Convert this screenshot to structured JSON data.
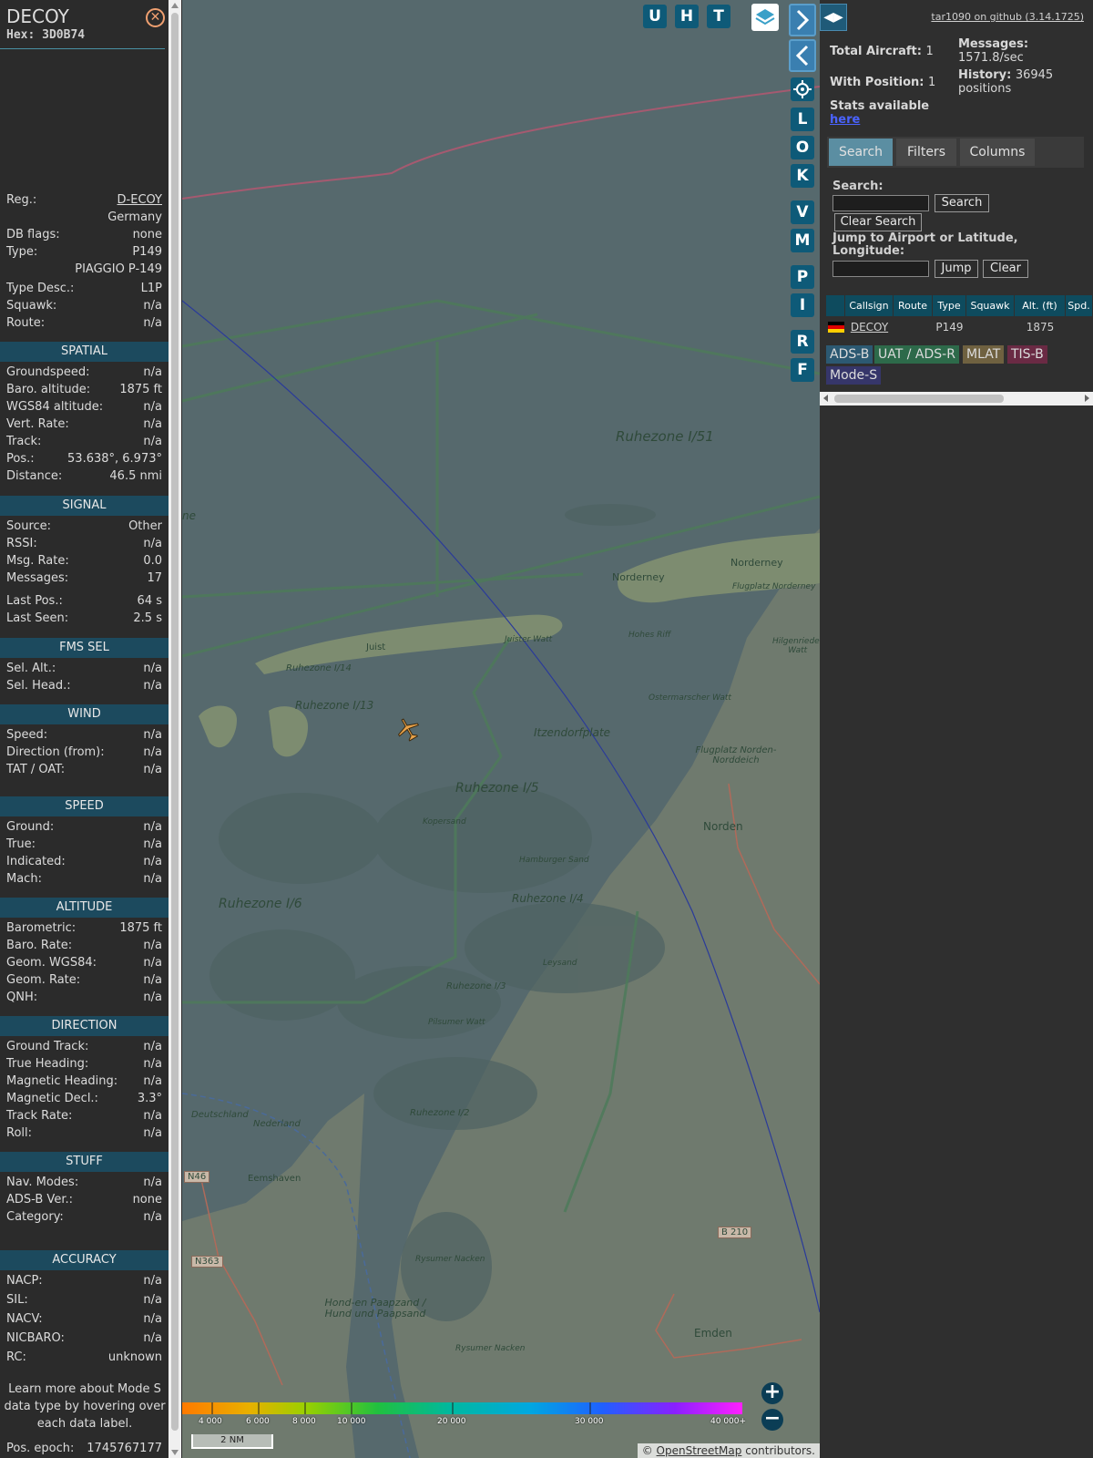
{
  "aircraft": {
    "callsign": "DECOY",
    "hex_label": "Hex:",
    "hex": "3D0B74",
    "close_icon": "close-circle-icon"
  },
  "details": [
    {
      "k": "Reg.:",
      "v": "D-ECOY",
      "link": true
    },
    {
      "k": "",
      "v": "Germany"
    },
    {
      "k": "DB flags:",
      "v": "none"
    },
    {
      "k": "Type:",
      "v": "P149"
    },
    {
      "k": "",
      "v": "PIAGGIO P-149"
    },
    {
      "k": "Type Desc.:",
      "v": "L1P"
    },
    {
      "k": "Squawk:",
      "v": "n/a"
    },
    {
      "k": "Route:",
      "v": "n/a"
    }
  ],
  "sections": [
    {
      "title": "SPATIAL",
      "rows": [
        {
          "k": "Groundspeed:",
          "v": "n/a"
        },
        {
          "k": "Baro. altitude:",
          "v": "1875 ft"
        },
        {
          "k": "WGS84 altitude:",
          "v": "n/a"
        },
        {
          "k": "Vert. Rate:",
          "v": "n/a"
        },
        {
          "k": "Track:",
          "v": "n/a"
        },
        {
          "k": "Pos.:",
          "v": "53.638°, 6.973°"
        },
        {
          "k": "Distance:",
          "v": "46.5 nmi"
        }
      ]
    },
    {
      "title": "SIGNAL",
      "rows": [
        {
          "k": "Source:",
          "v": "Other"
        },
        {
          "k": "RSSI:",
          "v": "n/a"
        },
        {
          "k": "Msg. Rate:",
          "v": "0.0"
        },
        {
          "k": "Messages:",
          "v": "17"
        },
        {
          "k": "Last Pos.:",
          "v": "64 s"
        },
        {
          "k": "Last Seen:",
          "v": "2.5 s"
        }
      ]
    },
    {
      "title": "FMS SEL",
      "rows": [
        {
          "k": "Sel. Alt.:",
          "v": "n/a"
        },
        {
          "k": "Sel. Head.:",
          "v": "n/a"
        }
      ]
    },
    {
      "title": "WIND",
      "rows": [
        {
          "k": "Speed:",
          "v": "n/a"
        },
        {
          "k": "Direction (from):",
          "v": "n/a"
        },
        {
          "k": "TAT / OAT:",
          "v": "n/a"
        }
      ]
    },
    {
      "title": "SPEED",
      "rows": [
        {
          "k": "Ground:",
          "v": "n/a"
        },
        {
          "k": "True:",
          "v": "n/a"
        },
        {
          "k": "Indicated:",
          "v": "n/a"
        },
        {
          "k": "Mach:",
          "v": "n/a"
        }
      ]
    },
    {
      "title": "ALTITUDE",
      "rows": [
        {
          "k": "Barometric:",
          "v": "1875 ft"
        },
        {
          "k": "Baro. Rate:",
          "v": "n/a"
        },
        {
          "k": "Geom. WGS84:",
          "v": "n/a"
        },
        {
          "k": "Geom. Rate:",
          "v": "n/a"
        },
        {
          "k": "QNH:",
          "v": "n/a"
        }
      ]
    },
    {
      "title": "DIRECTION",
      "rows": [
        {
          "k": "Ground Track:",
          "v": "n/a"
        },
        {
          "k": "True Heading:",
          "v": "n/a"
        },
        {
          "k": "Magnetic Heading:",
          "v": "n/a"
        },
        {
          "k": "Magnetic Decl.:",
          "v": "3.3°"
        },
        {
          "k": "Track Rate:",
          "v": "n/a"
        },
        {
          "k": "Roll:",
          "v": "n/a"
        }
      ]
    },
    {
      "title": "STUFF",
      "rows": [
        {
          "k": "Nav. Modes:",
          "v": "n/a"
        },
        {
          "k": "ADS-B Ver.:",
          "v": "none"
        },
        {
          "k": "Category:",
          "v": "n/a"
        }
      ]
    },
    {
      "title": "ACCURACY",
      "rows": [
        {
          "k": "NACP:",
          "v": "n/a"
        },
        {
          "k": "SIL:",
          "v": "n/a"
        },
        {
          "k": "NACV:",
          "v": "n/a"
        },
        {
          "k": "NICBARO:",
          "v": "n/a"
        },
        {
          "k": "RC:",
          "v": "unknown"
        }
      ]
    }
  ],
  "note": "Learn more about Mode S data type by hovering over each data label.",
  "pos_epoch": {
    "k": "Pos. epoch:",
    "v": "1745767177"
  },
  "map": {
    "top_buttons": [
      "U",
      "H",
      "T"
    ],
    "side_buttons": [
      "L",
      "O",
      "K",
      "V",
      "M",
      "P",
      "I",
      "R",
      "F"
    ],
    "layers_icon": "layers-icon",
    "settings_icon": "gear-icon",
    "forward_icon": "chevron-right-icon",
    "back_icon": "chevron-left-icon",
    "zoom_in": "+",
    "zoom_out": "−",
    "altitude_legend": [
      "4 000",
      "6 000",
      "8 000",
      "10 000",
      "20 000",
      "30 000",
      "40 000+"
    ],
    "scale": "2 NM",
    "credit_prefix": "© ",
    "credit_link": "OpenStreetMap",
    "credit_suffix": " contributors.",
    "labels": {
      "ruhezone_i51": "Ruhezone I/51",
      "ruhezone_i5": "Ruhezone I/5",
      "ruhezone_i6": "Ruhezone I/6",
      "ruhezone_i4": "Ruhezone I/4",
      "ruhezone_i3": "Ruhezone I/3",
      "ruhezone_i2": "Ruhezone I/2",
      "ruhezone_i13": "Ruhezone I/13",
      "ruhezone_i14": "Ruhezone I/14",
      "norderney_island": "Norderney",
      "norderney_town": "Norderney",
      "juist": "Juist",
      "juister_watt": "Juister Watt",
      "itzendorfplate": "Itzendorfplate",
      "norden": "Norden",
      "emden": "Emden",
      "eemshaven": "Eemshaven",
      "flugplatz_norderney": "Flugplatz Norderney",
      "flugplatz_norden": "Flugplatz Norden-Norddeich",
      "hohes_riff": "Hohes Riff",
      "hilgenrieder_watt": "Hilgenrieder Watt",
      "ostermarscher_watt": "Ostermarscher Watt",
      "kopersand": "Kopersand",
      "hamburger_sand": "Hamburger Sand",
      "leysand": "Leysand",
      "pilsumer_watt": "Pilsumer Watt",
      "rysumer_nacken1": "Rysumer Nacken",
      "rysumer_nacken2": "Rysumer Nacken",
      "hond_paapsand": "Hond-en Paapzand / Hund und Paapsand",
      "deutschland": "Deutschland",
      "nederland": "Nederland",
      "n46": "N46",
      "n363": "N363",
      "b210": "B 210",
      "ne": "ne"
    }
  },
  "stats": {
    "github": "tar1090 on github (3.14.1725)",
    "total_label": "Total Aircraft:",
    "total": "1",
    "withpos_label": "With Position:",
    "withpos": "1",
    "messages_label": "Messages:",
    "messages": "1571.8/sec",
    "history_label": "History:",
    "history": "36945 positions",
    "stats_available": "Stats available",
    "stats_link": "here"
  },
  "tabs": [
    "Search",
    "Filters",
    "Columns"
  ],
  "search": {
    "search_label": "Search:",
    "search_btn": "Search",
    "clear_search_btn": "Clear Search",
    "jump_label": "Jump to Airport or Latitude, Longitude:",
    "jump_btn": "Jump",
    "clear_btn": "Clear"
  },
  "table": {
    "columns": [
      "",
      "Callsign",
      "Route",
      "Type",
      "Squawk",
      "Alt. (ft)",
      "Spd."
    ],
    "rows": [
      {
        "flag": "germany-flag-icon",
        "callsign": "DECOY",
        "route": "",
        "type": "P149",
        "squawk": "",
        "alt": "1875",
        "spd": ""
      }
    ]
  },
  "source_badges": [
    {
      "label": "ADS-B",
      "color": "#2c5972"
    },
    {
      "label": "UAT / ADS-R",
      "color": "#2d6a4a"
    },
    {
      "label": "MLAT",
      "color": "#6f6140"
    },
    {
      "label": "TIS-B",
      "color": "#6a2a44"
    },
    {
      "label": "Mode-S",
      "color": "#36366a"
    }
  ],
  "colors": {
    "section_header": "#1c4a5e",
    "table_header": "#0e4b5e",
    "map_button": "#0e5a78",
    "aircraft_icon": "#e8a24a"
  }
}
